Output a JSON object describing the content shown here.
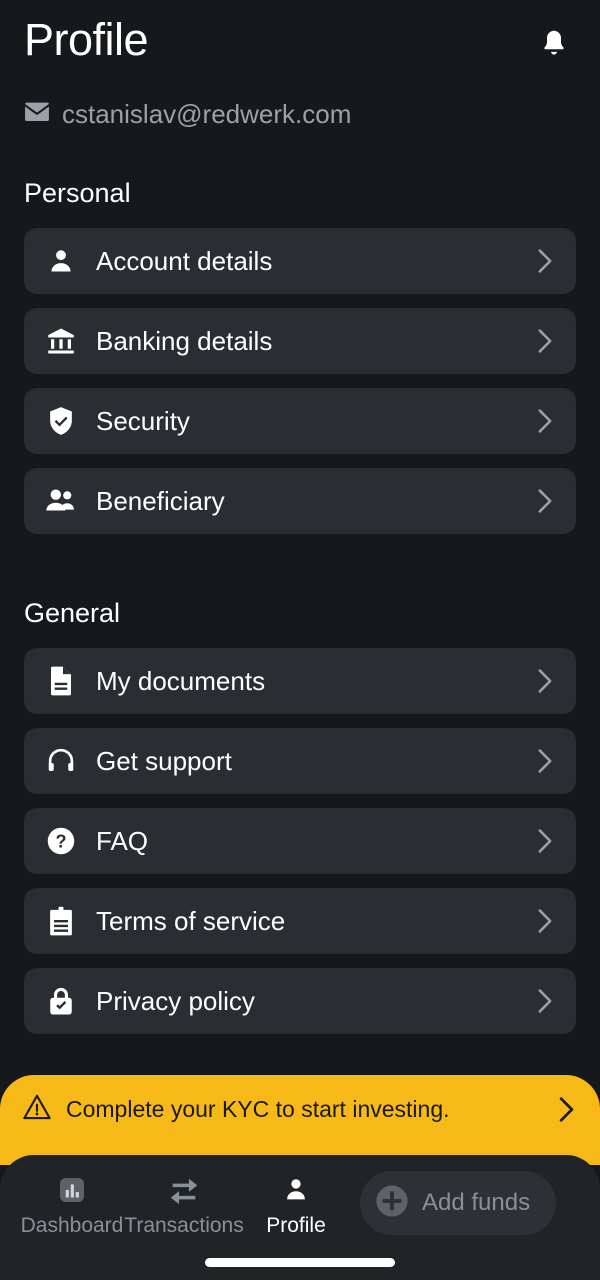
{
  "header": {
    "title": "Profile",
    "notification_icon": "bell-icon"
  },
  "account": {
    "email": "cstanislav@redwerk.com",
    "email_icon": "envelope-icon"
  },
  "sections": [
    {
      "title": "Personal",
      "items": [
        {
          "label": "Account details",
          "icon": "person-icon"
        },
        {
          "label": "Banking details",
          "icon": "bank-icon"
        },
        {
          "label": "Security",
          "icon": "shield-check-icon"
        },
        {
          "label": "Beneficiary",
          "icon": "people-icon"
        }
      ]
    },
    {
      "title": "General",
      "items": [
        {
          "label": "My documents",
          "icon": "document-icon"
        },
        {
          "label": "Get support",
          "icon": "headset-icon"
        },
        {
          "label": "FAQ",
          "icon": "question-circle-icon"
        },
        {
          "label": "Terms of service",
          "icon": "clipboard-icon"
        },
        {
          "label": "Privacy policy",
          "icon": "lock-check-icon"
        }
      ]
    }
  ],
  "kyc_banner": {
    "text": "Complete your KYC to start investing.",
    "icon": "warning-triangle-icon",
    "chevron": "chevron-right-icon",
    "background_color": "#F7B918",
    "text_color": "#1a1a1a"
  },
  "bottom_nav": {
    "items": [
      {
        "label": "Dashboard",
        "icon": "chart-bars-icon",
        "active": false
      },
      {
        "label": "Transactions",
        "icon": "swap-arrows-icon",
        "active": false
      },
      {
        "label": "Profile",
        "icon": "person-icon",
        "active": true
      }
    ],
    "add_funds": {
      "label": "Add funds",
      "icon": "plus-circle-icon"
    }
  },
  "colors": {
    "page_background": "#16191c",
    "card_background": "#2a2d31",
    "nav_background": "#212427",
    "accent": "#F7B918",
    "muted_text": "#8a9097"
  }
}
